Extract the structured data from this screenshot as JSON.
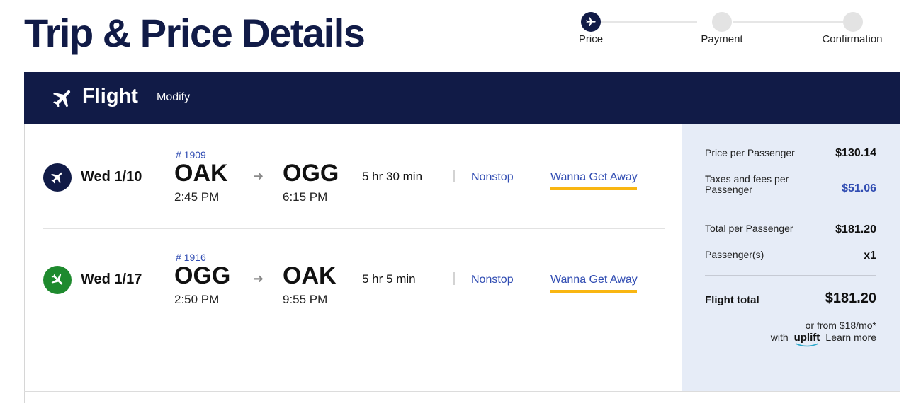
{
  "page": {
    "title": "Trip & Price Details"
  },
  "stepper": {
    "steps": [
      {
        "label": "Price",
        "active": true
      },
      {
        "label": "Payment",
        "active": false
      },
      {
        "label": "Confirmation",
        "active": false
      }
    ]
  },
  "card": {
    "header": {
      "title": "Flight",
      "modify_label": "Modify"
    },
    "flights": [
      {
        "date": "Wed 1/10",
        "flight_number": "# 1909",
        "origin": "OAK",
        "depart_time": "2:45 PM",
        "destination": "OGG",
        "arrive_time": "6:15 PM",
        "duration": "5 hr 30 min",
        "stops": "Nonstop",
        "fare": "Wanna Get Away"
      },
      {
        "date": "Wed 1/17",
        "flight_number": "# 1916",
        "origin": "OGG",
        "depart_time": "2:50 PM",
        "destination": "OAK",
        "arrive_time": "9:55 PM",
        "duration": "5 hr 5 min",
        "stops": "Nonstop",
        "fare": "Wanna Get Away"
      }
    ]
  },
  "summary": {
    "price_per_passenger_label": "Price per Passenger",
    "price_per_passenger": "$130.14",
    "taxes_label_line1": "Taxes and fees per",
    "taxes_label_line2": "Passenger",
    "taxes": "$51.06",
    "total_per_passenger_label": "Total per Passenger",
    "total_per_passenger": "$181.20",
    "passengers_label": "Passenger(s)",
    "passengers": "x1",
    "flight_total_label": "Flight total",
    "flight_total": "$181.20",
    "uplift_line1": "or from $18/mo*",
    "uplift_with": "with",
    "uplift_brand": "uplift",
    "learn_more": "Learn more"
  },
  "colors": {
    "navy": "#111b47",
    "link_blue": "#304cb2",
    "fare_underline": "#f9b612",
    "inbound_green": "#1e8a2e",
    "summary_bg": "#e6ecf7"
  },
  "icons": {
    "step_active": "plane-icon",
    "header": "plane-icon",
    "outbound": "plane-icon",
    "inbound": "plane-icon",
    "arrow": "arrow-right-icon"
  }
}
